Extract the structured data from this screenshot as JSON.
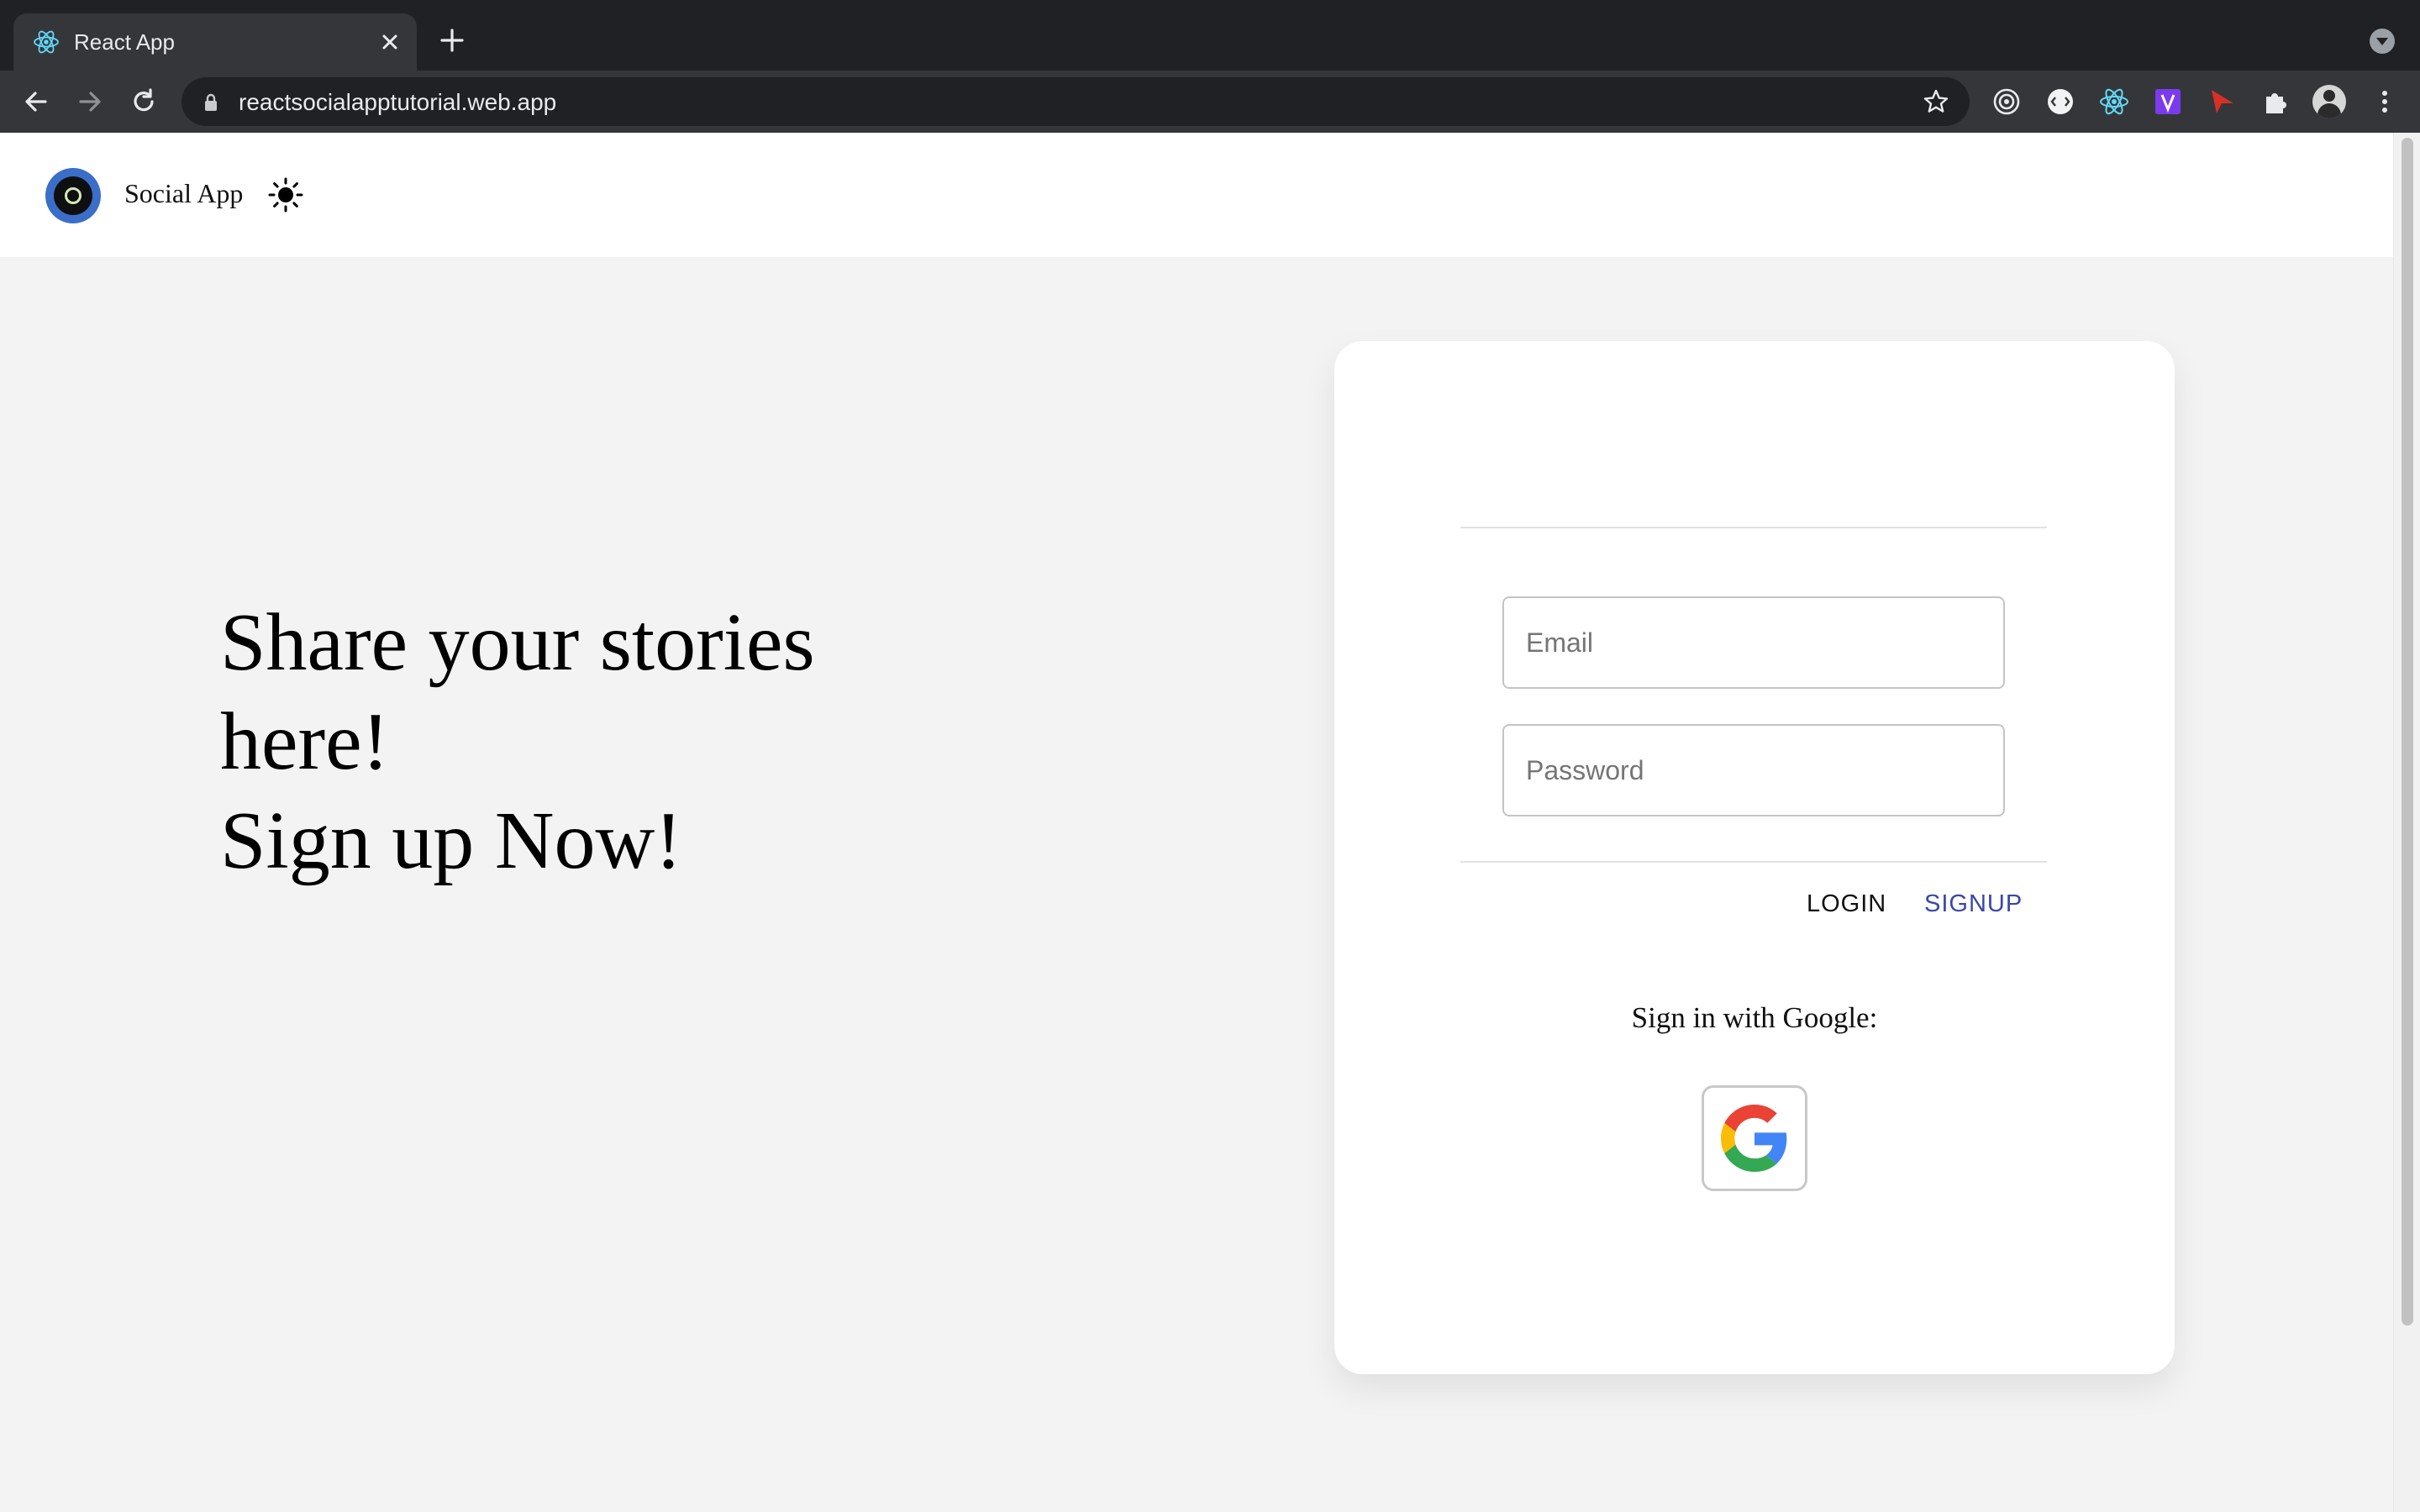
{
  "browser": {
    "tab_title": "React App",
    "url": "reactsocialapptutorial.web.app"
  },
  "icons": {
    "tab_favicon": "react-logo-icon",
    "tab_close": "close-icon",
    "new_tab": "plus-icon",
    "tab_search": "chevron-down-icon",
    "back": "arrow-left-icon",
    "forward": "arrow-right-icon",
    "reload": "reload-icon",
    "lock": "lock-icon",
    "bookmark": "star-icon",
    "extensions": [
      "target-icon",
      "code-bubble-icon",
      "react-devtools-icon",
      "v-extension-icon",
      "red-arrow-icon",
      "puzzle-icon",
      "profile-avatar-icon",
      "kebab-menu-icon"
    ],
    "theme_toggle": "sun-icon",
    "google": "google-g-icon"
  },
  "app": {
    "brand": "Social App",
    "hero_lines": [
      "Share your stories",
      "here!",
      "Sign up Now!"
    ]
  },
  "auth": {
    "email_placeholder": "Email",
    "email_value": "",
    "password_placeholder": "Password",
    "password_value": "",
    "login_label": "LOGIN",
    "signup_label": "SIGNUP",
    "google_label": "Sign in with Google:"
  },
  "colors": {
    "page_bg": "#f3f3f3",
    "card_bg": "#ffffff",
    "signup_accent": "#3947a8",
    "logo_blue": "#3b6ec8",
    "chrome_dark": "#202124"
  }
}
